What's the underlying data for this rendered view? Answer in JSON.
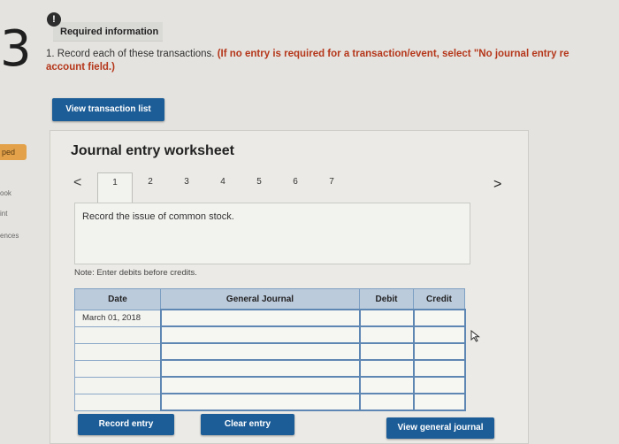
{
  "question_number": "3",
  "alert_glyph": "!",
  "required_title": "Required information",
  "instruction": {
    "prefix": "1. Record each of these transactions. ",
    "emphasis": "(If no entry is required for a transaction/event, select \"No journal entry re",
    "emphasis_line2": "account field.)"
  },
  "view_transaction_list_label": "View transaction list",
  "side_nav": {
    "tag": "ped",
    "items": [
      "ook",
      "int",
      "ences"
    ]
  },
  "worksheet": {
    "title": "Journal entry worksheet",
    "prev_glyph": "<",
    "next_glyph": ">",
    "tabs": [
      "1",
      "2",
      "3",
      "4",
      "5",
      "6",
      "7"
    ],
    "active_tab": "1",
    "description": "Record the issue of common stock.",
    "note": "Note: Enter debits before credits."
  },
  "journal_table": {
    "headers": {
      "date": "Date",
      "account": "General Journal",
      "debit": "Debit",
      "credit": "Credit"
    },
    "rows": [
      {
        "date": "March 01, 2018",
        "account": "",
        "debit": "",
        "credit": ""
      },
      {
        "date": "",
        "account": "",
        "debit": "",
        "credit": ""
      },
      {
        "date": "",
        "account": "",
        "debit": "",
        "credit": ""
      },
      {
        "date": "",
        "account": "",
        "debit": "",
        "credit": ""
      },
      {
        "date": "",
        "account": "",
        "debit": "",
        "credit": ""
      },
      {
        "date": "",
        "account": "",
        "debit": "",
        "credit": ""
      }
    ]
  },
  "buttons": {
    "record_entry": "Record entry",
    "clear_entry": "Clear entry",
    "view_general_journal": "View general journal"
  },
  "colors": {
    "button_blue": "#1c5d97",
    "header_blue": "#bccbdc",
    "alert_red": "#b5371b",
    "side_tag_orange": "#e3a24a"
  }
}
